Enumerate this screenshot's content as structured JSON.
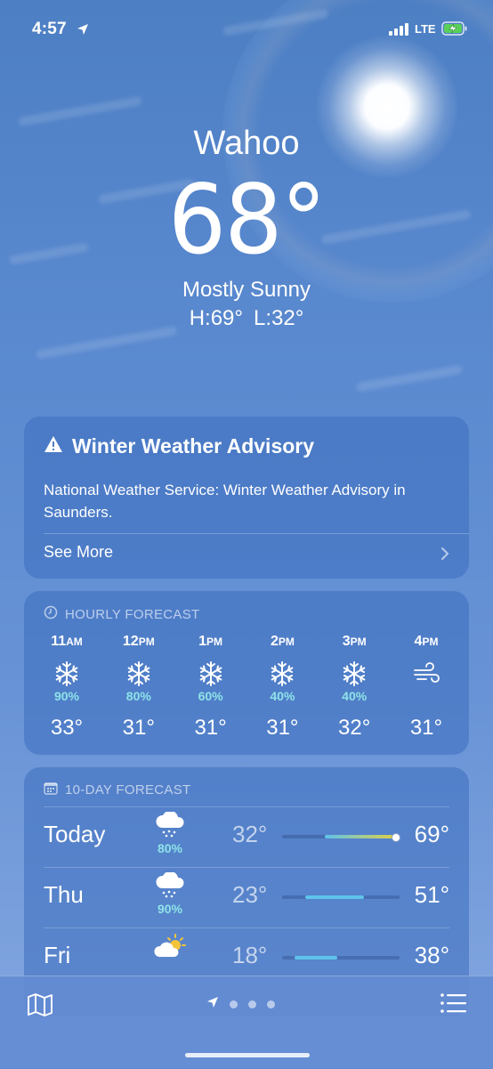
{
  "status_bar": {
    "time": "4:57",
    "network": "LTE"
  },
  "location": {
    "city": "Wahoo",
    "temperature": "68°",
    "condition": "Mostly Sunny",
    "high": "H:69°",
    "low": "L:32°"
  },
  "advisory": {
    "title": "Winter Weather Advisory",
    "body": "National Weather Service: Winter Weather Advisory in Saunders.",
    "see_more": "See More"
  },
  "hourly": {
    "header": "HOURLY FORECAST",
    "items": [
      {
        "hour": "11",
        "ampm": "AM",
        "icon": "snowflake-icon",
        "precip": "90%",
        "temp": "33°"
      },
      {
        "hour": "12",
        "ampm": "PM",
        "icon": "snowflake-icon",
        "precip": "80%",
        "temp": "31°"
      },
      {
        "hour": "1",
        "ampm": "PM",
        "icon": "snowflake-icon",
        "precip": "60%",
        "temp": "31°"
      },
      {
        "hour": "2",
        "ampm": "PM",
        "icon": "snowflake-icon",
        "precip": "40%",
        "temp": "31°"
      },
      {
        "hour": "3",
        "ampm": "PM",
        "icon": "snowflake-icon",
        "precip": "40%",
        "temp": "32°"
      },
      {
        "hour": "4",
        "ampm": "PM",
        "icon": "wind-icon",
        "precip": "",
        "temp": "31°"
      }
    ]
  },
  "ten_day": {
    "header": "10-DAY FORECAST",
    "days": [
      {
        "day": "Today",
        "icon": "rain-snow-cloud-icon",
        "precip": "80%",
        "low": "32°",
        "high": "69°"
      },
      {
        "day": "Thu",
        "icon": "rain-snow-cloud-icon",
        "precip": "90%",
        "low": "23°",
        "high": "51°"
      },
      {
        "day": "Fri",
        "icon": "partly-sunny-icon",
        "precip": "",
        "low": "18°",
        "high": "38°"
      }
    ]
  },
  "colors": {
    "precip": "#8ee3e8",
    "range_warm": "#d9d04a",
    "range_cool": "#5fc3ec"
  },
  "tab_bar": {
    "page_count": 3,
    "current_is_location": true
  }
}
